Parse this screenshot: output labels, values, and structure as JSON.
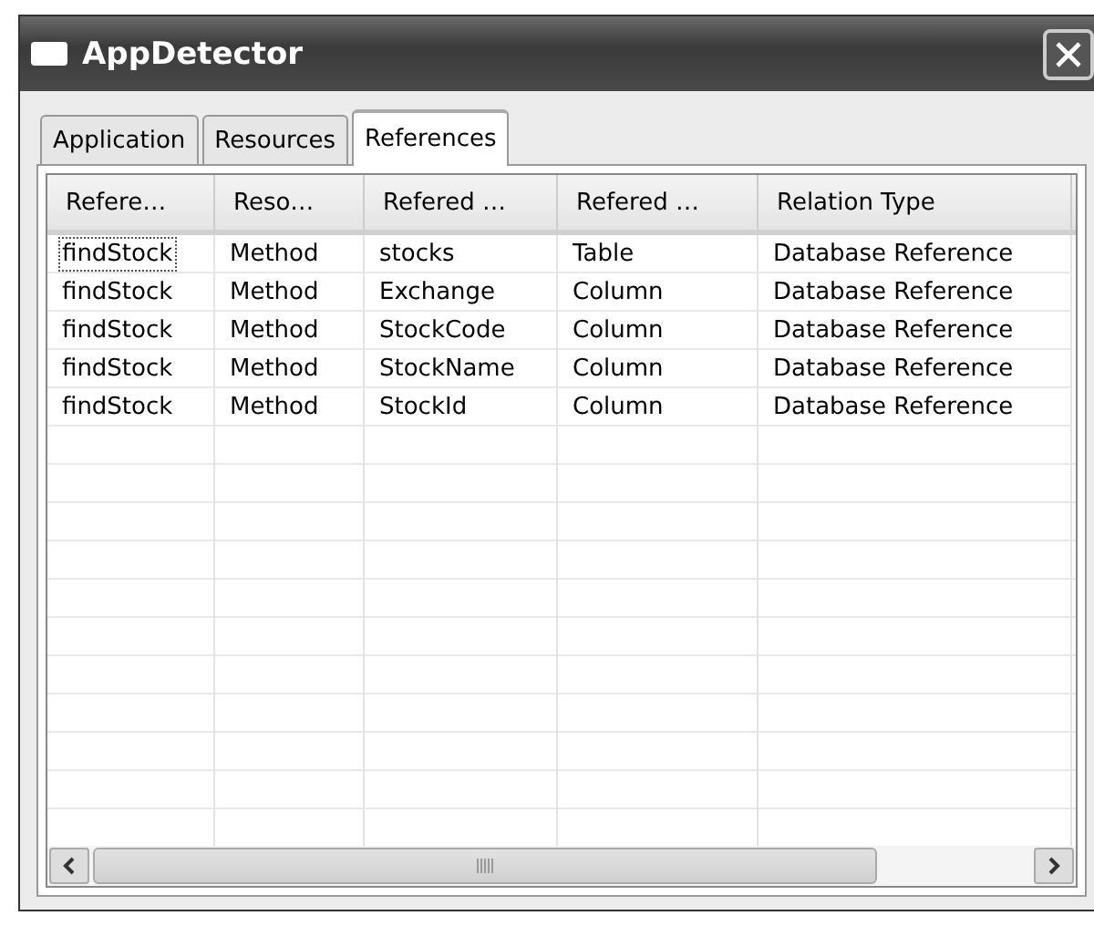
{
  "window": {
    "title": "AppDetector"
  },
  "tabs": [
    {
      "label": "Application",
      "selected": false
    },
    {
      "label": "Resources",
      "selected": false
    },
    {
      "label": "References",
      "selected": true
    }
  ],
  "table": {
    "columns": [
      "Refere…",
      "Reso…",
      "Refered …",
      "Refered …",
      "Relation Type"
    ],
    "rows": [
      {
        "cells": [
          "findStock",
          "Method",
          "stocks",
          "Table",
          "Database Reference"
        ],
        "focused": true
      },
      {
        "cells": [
          "findStock",
          "Method",
          "Exchange",
          "Column",
          "Database Reference"
        ],
        "focused": false
      },
      {
        "cells": [
          "findStock",
          "Method",
          "StockCode",
          "Column",
          "Database Reference"
        ],
        "focused": false
      },
      {
        "cells": [
          "findStock",
          "Method",
          "StockName",
          "Column",
          "Database Reference"
        ],
        "focused": false
      },
      {
        "cells": [
          "findStock",
          "Method",
          "StockId",
          "Column",
          "Database Reference"
        ],
        "focused": false
      }
    ]
  }
}
